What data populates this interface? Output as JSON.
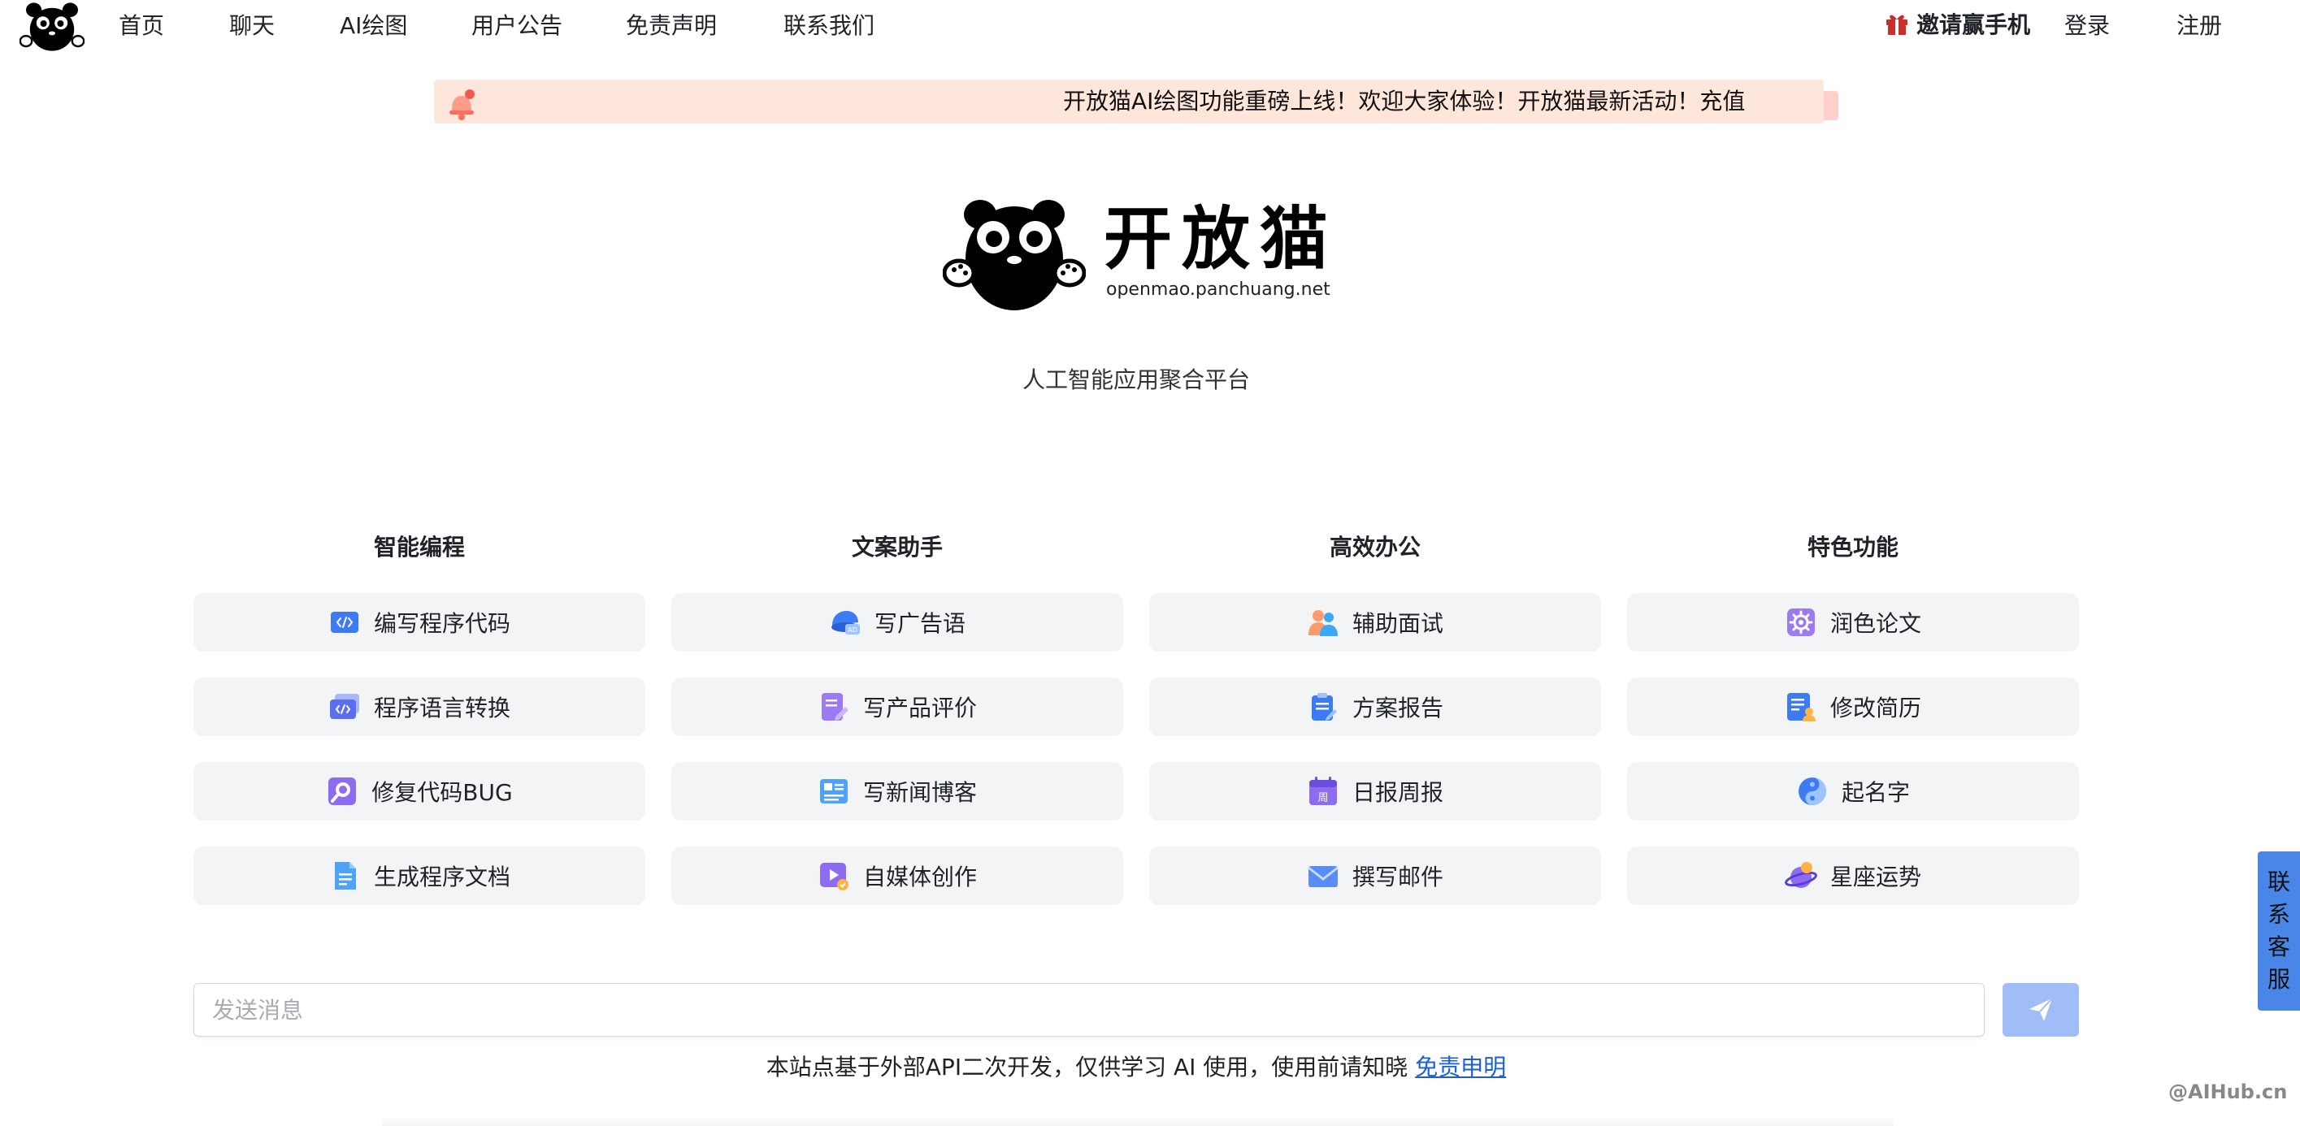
{
  "nav": {
    "items": [
      "首页",
      "聊天",
      "AI绘图",
      "用户公告",
      "免责声明",
      "联系我们"
    ],
    "invite_label": "邀请赢手机",
    "login_label": "登录",
    "register_label": "注册"
  },
  "notice": {
    "text": "开放猫AI绘图功能重磅上线！欢迎大家体验！开放猫最新活动！充值"
  },
  "brand": {
    "name": "开放猫",
    "domain": "openmao.panchuang.net",
    "tagline": "人工智能应用聚合平台"
  },
  "columns": [
    {
      "title": "智能编程",
      "items": [
        {
          "label": "编写程序代码",
          "icon": "code-icon"
        },
        {
          "label": "程序语言转换",
          "icon": "code-convert-icon"
        },
        {
          "label": "修复代码BUG",
          "icon": "bug-fix-icon"
        },
        {
          "label": "生成程序文档",
          "icon": "document-icon"
        }
      ]
    },
    {
      "title": "文案助手",
      "items": [
        {
          "label": "写广告语",
          "icon": "ad-icon"
        },
        {
          "label": "写产品评价",
          "icon": "review-icon"
        },
        {
          "label": "写新闻博客",
          "icon": "news-icon"
        },
        {
          "label": "自媒体创作",
          "icon": "media-icon"
        }
      ]
    },
    {
      "title": "高效办公",
      "items": [
        {
          "label": "辅助面试",
          "icon": "interview-icon"
        },
        {
          "label": "方案报告",
          "icon": "report-icon"
        },
        {
          "label": "日报周报",
          "icon": "calendar-icon"
        },
        {
          "label": "撰写邮件",
          "icon": "mail-icon"
        }
      ]
    },
    {
      "title": "特色功能",
      "items": [
        {
          "label": "润色论文",
          "icon": "polish-icon"
        },
        {
          "label": "修改简历",
          "icon": "resume-icon"
        },
        {
          "label": "起名字",
          "icon": "naming-icon"
        },
        {
          "label": "星座运势",
          "icon": "horoscope-icon"
        }
      ]
    }
  ],
  "input": {
    "placeholder": "发送消息",
    "value": ""
  },
  "footer": {
    "text": "本站点基于外部API二次开发，仅供学习 AI 使用，使用前请知晓 ",
    "link": "免责申明"
  },
  "contact": {
    "chars": [
      "联",
      "系",
      "客",
      "服"
    ]
  },
  "watermark": "@AIHub.cn"
}
